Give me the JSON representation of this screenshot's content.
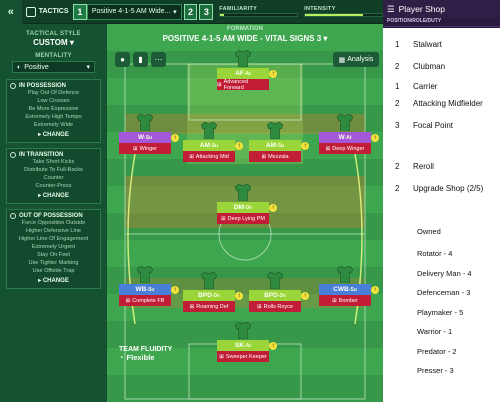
{
  "topbar": {
    "back_glyph": "«",
    "tab_label": "TACTICS",
    "slots": [
      {
        "num": "1",
        "name": "Positive 4-1-5 AM Wide..."
      },
      {
        "num": "2",
        "name": ""
      },
      {
        "num": "3",
        "name": ""
      }
    ],
    "familiarity_label": "FAMILIARITY",
    "intensity_label": "INTENSITY",
    "familiarity_level": 0.05,
    "intensity_level": 0.75
  },
  "sidebar": {
    "style_label": "TACTICAL STYLE",
    "style_value": "CUSTOM",
    "mentality_label": "MENTALITY",
    "mentality_value": "Positive",
    "panels": [
      {
        "title": "IN POSSESSION",
        "items": [
          "Play Out Of Defence",
          "Low Crosses",
          "Be More Expressive",
          "Extremely High Tempo",
          "Extremely Wide"
        ],
        "change": "CHANGE"
      },
      {
        "title": "IN TRANSITION",
        "items": [
          "Take Short Kicks",
          "Distribute To Full-Backs",
          "Counter",
          "Counter-Press"
        ],
        "change": "CHANGE"
      },
      {
        "title": "OUT OF POSSESSION",
        "items": [
          "Force Opposition Outside",
          "Higher Defensive Line",
          "Higher Line Of Engagement",
          "Extremely Urgent",
          "Stay On Feet",
          "Use Tighter Marking",
          "Use Offside Trap"
        ],
        "change": "CHANGE"
      }
    ]
  },
  "pitch": {
    "formation_label": "FORMATION",
    "formation_value": "POSITIVE 4-1-5 AM WIDE - VITAL SIGNS 3",
    "analysis_label": "Analysis",
    "fluidity_label": "TEAM FLUIDITY",
    "fluidity_value": "Flexible",
    "players": [
      {
        "pos": "AF",
        "duty": "At",
        "role": "Advanced Forward"
      },
      {
        "pos": "W",
        "duty": "Su",
        "role": "Winger"
      },
      {
        "pos": "AM",
        "duty": "Su",
        "role": "Attacking Mid"
      },
      {
        "pos": "AM",
        "duty": "Su",
        "role": "Mezzala"
      },
      {
        "pos": "W",
        "duty": "At",
        "role": "Deep Winger"
      },
      {
        "pos": "DM",
        "duty": "De",
        "role": "Deep Lying PM"
      },
      {
        "pos": "WB",
        "duty": "Su",
        "role": "Complete FB"
      },
      {
        "pos": "BPD",
        "duty": "De",
        "role": "Roaming Def"
      },
      {
        "pos": "BPD",
        "duty": "De",
        "role": "Rolls Royce"
      },
      {
        "pos": "CWB",
        "duty": "Su",
        "role": "Bomber"
      },
      {
        "pos": "SK",
        "duty": "At",
        "role": "Sweeper Keeper"
      }
    ]
  },
  "shop": {
    "title": "Player Shop",
    "subheader": "POSITION/ROLE/DUTY",
    "items": [
      {
        "n": "1",
        "label": "Stalwart"
      },
      {
        "n": "2",
        "label": "Clubman"
      },
      {
        "n": "1",
        "label": "Carrier"
      },
      {
        "n": "2",
        "label": "Attacking Midfielder"
      },
      {
        "n": "3",
        "label": "Focal Point"
      },
      {
        "n": "2",
        "label": "Reroll"
      },
      {
        "n": "2",
        "label": "Upgrade Shop (2/5)"
      }
    ],
    "owned_title": "Owned",
    "owned": [
      "Rotator - 4",
      "Delivery Man - 4",
      "Defenceman - 3",
      "Playmaker - 5",
      "Warrior - 1",
      "Predator - 2",
      "Presser - 3"
    ]
  },
  "colors": {
    "pitch_green": "#3aa14c",
    "role_red": "#c21d37",
    "shop_purple": "#2a1a3f"
  }
}
